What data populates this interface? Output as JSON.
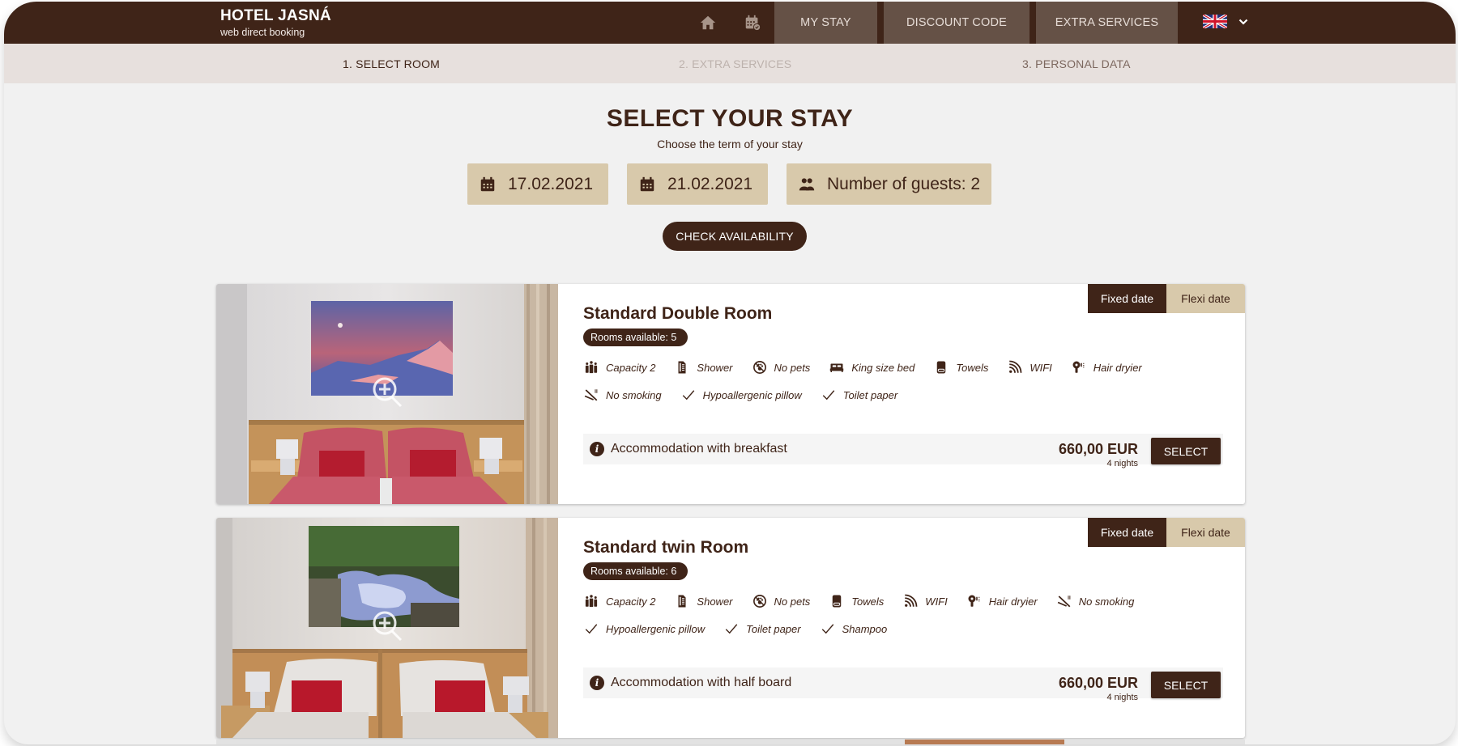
{
  "header": {
    "brand_title": "HOTEL JASNÁ",
    "brand_subtitle": "web direct booking",
    "icons": [
      "home-icon",
      "calendar-check-icon"
    ],
    "nav": [
      {
        "label": "MY STAY"
      },
      {
        "label": "DISCOUNT CODE"
      },
      {
        "label": "EXTRA SERVICES"
      }
    ],
    "language": {
      "flag": "uk-flag-icon",
      "dropdown_icon": "chevron-down-icon"
    }
  },
  "steps": [
    {
      "label": "1. SELECT ROOM",
      "state": "active"
    },
    {
      "label": "2. EXTRA SERVICES",
      "state": "disabled"
    },
    {
      "label": "3. PERSONAL DATA",
      "state": "upcoming"
    }
  ],
  "search": {
    "title": "SELECT YOUR STAY",
    "subtitle": "Choose the term of your stay",
    "date_from": "17.02.2021",
    "date_to": "21.02.2021",
    "guests_label": "Number of guests: 2",
    "check_button": "CHECK AVAILABILITY"
  },
  "colors": {
    "brand_dark": "#3f2418",
    "nav_item_bg": "#655146",
    "beige": "#d8c9ab",
    "steps_bg": "#e7e0dd",
    "page_bg": "#f1f1f1"
  },
  "rooms": [
    {
      "name": "Standard Double Room",
      "availability": "Rooms available: 5",
      "tabs": [
        "Fixed date",
        "Flexi date"
      ],
      "active_tab": "Fixed date",
      "amenities_row1": [
        {
          "icon": "people-icon",
          "label": "Capacity 2"
        },
        {
          "icon": "shower-icon",
          "label": "Shower"
        },
        {
          "icon": "no-pets-icon",
          "label": "No pets"
        },
        {
          "icon": "bed-icon",
          "label": "King size bed"
        },
        {
          "icon": "towel-icon",
          "label": "Towels"
        },
        {
          "icon": "wifi-icon",
          "label": "WIFI"
        },
        {
          "icon": "hair-dryer-icon",
          "label": "Hair dryier"
        }
      ],
      "amenities_row2": [
        {
          "icon": "no-smoking-icon",
          "label": "No smoking"
        },
        {
          "icon": "check-icon",
          "label": "Hypoallergenic pillow"
        },
        {
          "icon": "check-icon",
          "label": "Toilet paper"
        }
      ],
      "offer": {
        "label": "Accommodation with breakfast",
        "price": "660,00 EUR",
        "nights": "4 nights",
        "button": "SELECT"
      }
    },
    {
      "name": "Standard twin Room",
      "availability": "Rooms available: 6",
      "tabs": [
        "Fixed date",
        "Flexi date"
      ],
      "active_tab": "Fixed date",
      "amenities_row1": [
        {
          "icon": "people-icon",
          "label": "Capacity 2"
        },
        {
          "icon": "shower-icon",
          "label": "Shower"
        },
        {
          "icon": "no-pets-icon",
          "label": "No pets"
        },
        {
          "icon": "towel-icon",
          "label": "Towels"
        },
        {
          "icon": "wifi-icon",
          "label": "WIFI"
        },
        {
          "icon": "hair-dryer-icon",
          "label": "Hair dryier"
        },
        {
          "icon": "no-smoking-icon",
          "label": "No smoking"
        }
      ],
      "amenities_row2": [
        {
          "icon": "check-icon",
          "label": "Hypoallergenic pillow"
        },
        {
          "icon": "check-icon",
          "label": "Toilet paper"
        },
        {
          "icon": "check-icon",
          "label": "Shampoo"
        }
      ],
      "offer": {
        "label": "Accommodation with half board",
        "price": "660,00 EUR",
        "nights": "4 nights",
        "button": "SELECT"
      }
    }
  ]
}
